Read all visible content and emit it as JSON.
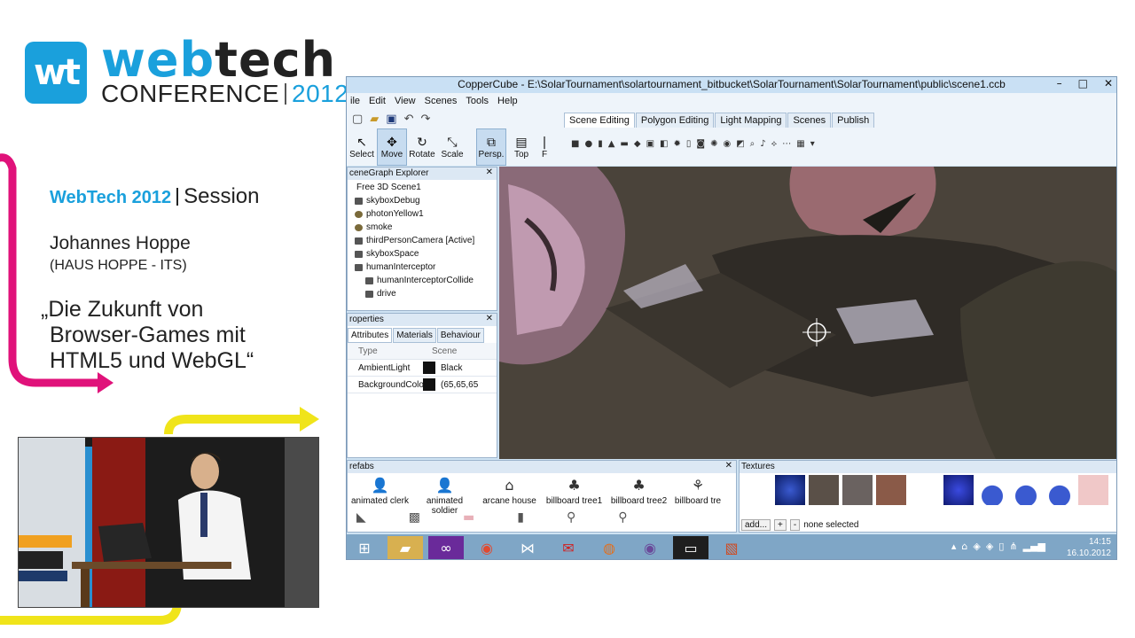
{
  "logo": {
    "mark": "wt",
    "word_a": "web",
    "word_b": "tech",
    "conference": "CONFERENCE",
    "year": "2012"
  },
  "session": {
    "event": "WebTech 2012",
    "label": "Session"
  },
  "speaker": {
    "name": "Johannes Hoppe",
    "org": "(HAUS HOPPE - ITS)"
  },
  "talk": {
    "line1": "„Die Zukunft von",
    "line2": "Browser-Games mit",
    "line3": "HTML5 und WebGL“"
  },
  "colors": {
    "brand_blue": "#1aa0dc",
    "magenta": "#e0127a",
    "yellow": "#f0e41a"
  },
  "window": {
    "title": "CopperCube - E:\\SolarTournament\\solartournament_bitbucket\\SolarTournament\\SolarTournament\\public\\scene1.ccb",
    "controls": [
      "–",
      "□",
      "✕"
    ]
  },
  "menu": [
    "ile",
    "Edit",
    "View",
    "Scenes",
    "Tools",
    "Help"
  ],
  "tools": [
    {
      "icon": "↖",
      "label": "Select"
    },
    {
      "icon": "✥",
      "label": "Move"
    },
    {
      "icon": "↻",
      "label": "Rotate"
    },
    {
      "icon": "⤡",
      "label": "Scale"
    }
  ],
  "view_tools": [
    {
      "icon": "⧉",
      "label": "Persp."
    },
    {
      "icon": "▤",
      "label": "Top"
    },
    {
      "icon": "|",
      "label": "F"
    }
  ],
  "scene_tabs": [
    "Scene Editing",
    "Polygon Editing",
    "Light Mapping",
    "Scenes",
    "Publish"
  ],
  "scenegraph": {
    "title": "ceneGraph Explorer",
    "items": [
      "Free 3D Scene1",
      "skyboxDebug",
      "photonYellow1",
      "smoke",
      "thirdPersonCamera [Active]",
      "skyboxSpace",
      "humanInterceptor",
      "humanInterceptorCollide",
      "drive"
    ]
  },
  "properties": {
    "title": "roperties",
    "tabs": [
      "Attributes",
      "Materials",
      "Behaviour"
    ],
    "header": {
      "type": "Type",
      "scene": "Scene"
    },
    "rows": [
      {
        "name": "AmbientLight",
        "value": "Black"
      },
      {
        "name": "BackgroundColor",
        "value": "(65,65,65"
      }
    ]
  },
  "prefabs": {
    "title": "refabs",
    "items": [
      "animated clerk",
      "animated soldier",
      "arcane house",
      "billboard tree1",
      "billboard tree2",
      "billboard tre"
    ]
  },
  "textures": {
    "title": "Textures",
    "add": "add...",
    "plus": "+",
    "minus": "-",
    "status": "none selected"
  },
  "clock": {
    "time": "14:15",
    "date": "16.10.2012"
  }
}
